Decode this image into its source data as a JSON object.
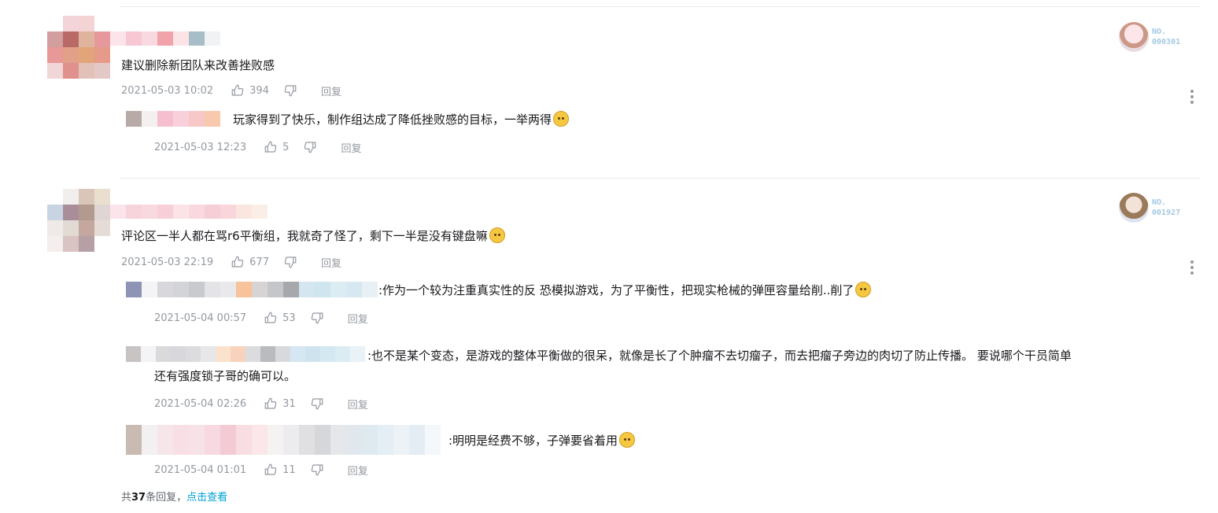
{
  "comments": [
    {
      "text": "建议删除新团队来改善挫败感",
      "time": "2021-05-03 10:02",
      "likes": "394",
      "reply_label": "回复",
      "badge": {
        "label": "NO.",
        "number": "000301"
      },
      "replies": [
        {
          "text": "玩家得到了快乐，制作组达成了降低挫败感的目标，一举两得",
          "time": "2021-05-03 12:23",
          "likes": "5",
          "reply_label": "回复"
        }
      ]
    },
    {
      "text": "评论区一半人都在骂r6平衡组，我就奇了怪了，剩下一半是没有键盘嘛",
      "time": "2021-05-03 22:19",
      "likes": "677",
      "reply_label": "回复",
      "badge": {
        "label": "NO.",
        "number": "001927"
      },
      "replies": [
        {
          "text": ":作为一个较为注重真实性的反 恐模拟游戏，为了平衡性，把现实枪械的弹匣容量给削..削了",
          "time": "2021-05-04 00:57",
          "likes": "53",
          "reply_label": "回复"
        },
        {
          "text": ":也不是某个变态，是游戏的整体平衡做的很呆，就像是长了个肿瘤不去切瘤子，而去把瘤子旁边的肉切了防止传播。    要说哪个干员简单",
          "text_line2": "还有强度锁子哥的确可以。",
          "time": "2021-05-04 02:26",
          "likes": "31",
          "reply_label": "回复"
        },
        {
          "text": ":明明是经费不够，子弹要省着用",
          "time": "2021-05-04 01:01",
          "likes": "11",
          "reply_label": "回复"
        }
      ]
    }
  ],
  "footer": {
    "prefix": "共",
    "count": "37",
    "suffix": "条回复，",
    "link": "点击查看"
  },
  "icons": {
    "like": "thumbs-up-icon",
    "dislike": "thumbs-down-icon",
    "more": "more-vertical-icon",
    "emoji": "dog-emoji-icon"
  },
  "colors": {
    "meta": "#9499a0",
    "link": "#00a1d6",
    "divider": "#e5e9ef"
  }
}
